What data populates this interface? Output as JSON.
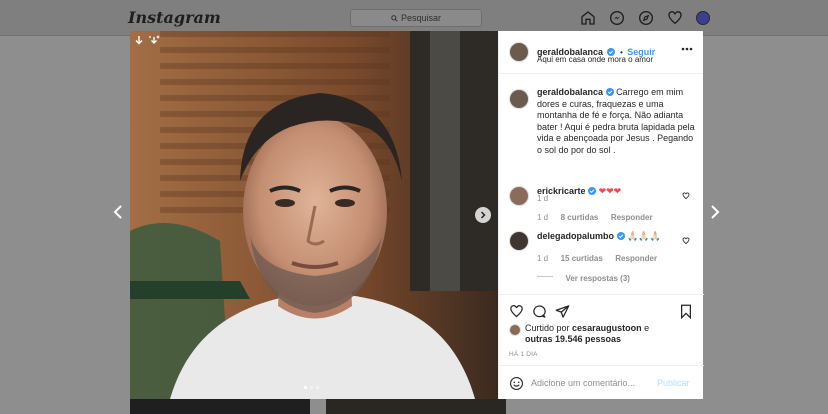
{
  "topbar": {
    "logo": "Instagram",
    "search_placeholder": "Pesquisar"
  },
  "post": {
    "author": "geraldobalanca",
    "follow_label": "Seguir",
    "follow_separator": "•",
    "location": "Aqui em casa onde mora o amor",
    "caption": "Carrego em mim dores e curas, fraquezas e uma montanha de fé e força. Não adianta bater ! Aqui é pedra bruta lapidada pela vida e abençoada por Jesus . Pegando o sol do por do sol .",
    "caption_age": "1 d",
    "comments": [
      {
        "user": "erickricarte",
        "text": "❤❤❤",
        "age": "1 d",
        "likes": "8 curtidas",
        "reply": "Responder"
      },
      {
        "user": "delegadopalumbo",
        "text": "🙏🏻🙏🏻🙏🏻",
        "age": "1 d",
        "likes": "15 curtidas",
        "reply": "Responder"
      }
    ],
    "view_replies": "Ver respostas (3)",
    "liked_by_prefix": "Curtido por",
    "liked_by_user": "cesaraugustoon",
    "liked_by_mid": "e",
    "liked_by_others": "outras 19.546 pessoas",
    "timestamp": "HÁ 1 DIA",
    "comment_placeholder": "Adicione um comentário...",
    "publish_label": "Publicar"
  },
  "colors": {
    "accent": "#3897f0",
    "verified": "#3897f0",
    "heart_red": "#ed4956"
  },
  "icons": [
    "home-icon",
    "messenger-icon",
    "explore-icon",
    "heart-icon",
    "avatar"
  ]
}
